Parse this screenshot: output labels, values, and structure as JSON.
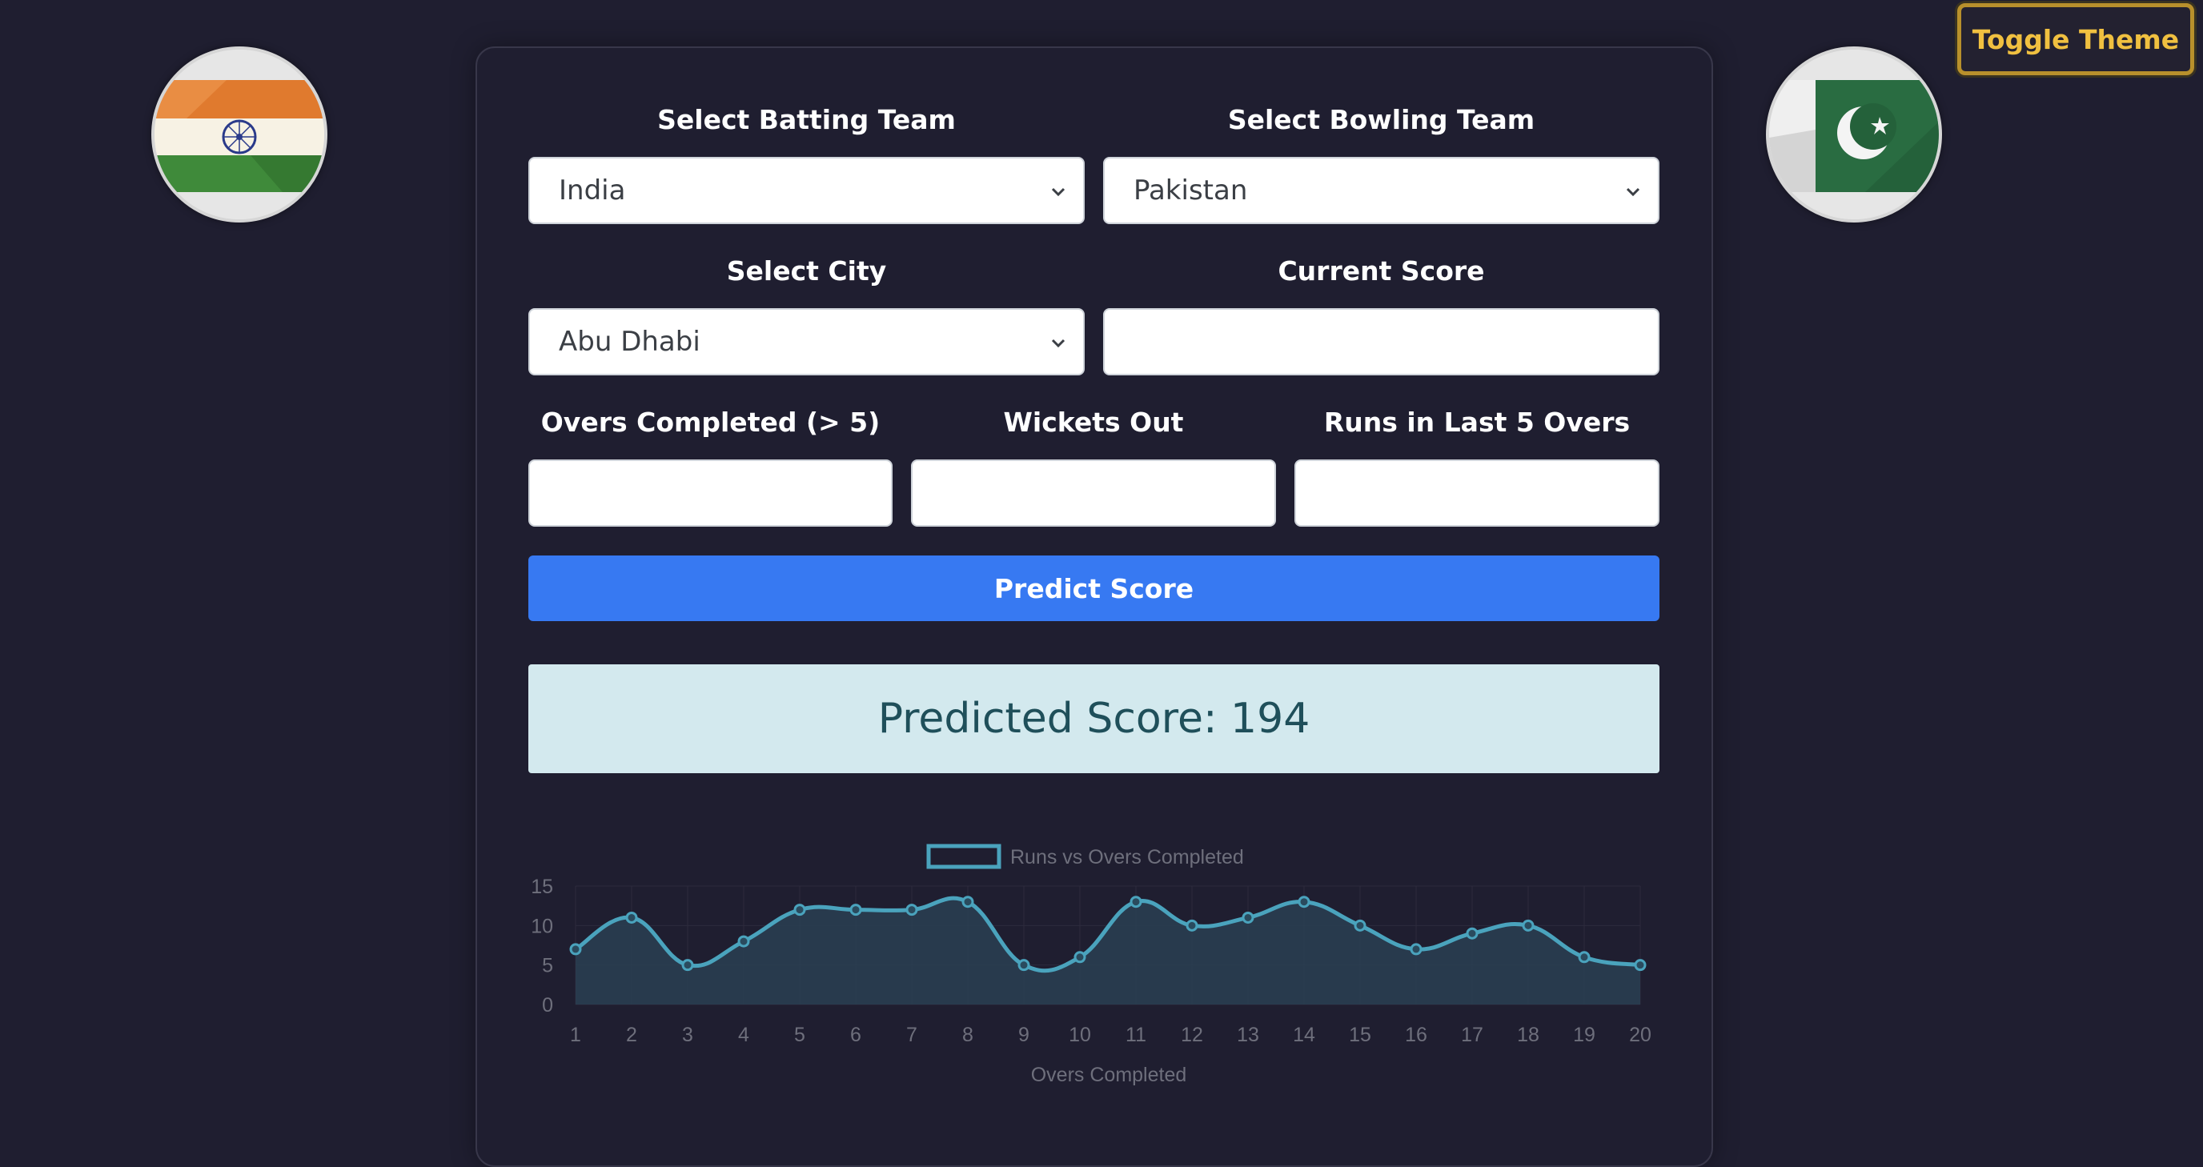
{
  "toolbar": {
    "toggle_theme_label": "Toggle Theme"
  },
  "flags": {
    "left": "India flag",
    "right": "Pakistan flag"
  },
  "form": {
    "batting_label": "Select Batting Team",
    "batting_value": "India",
    "bowling_label": "Select Bowling Team",
    "bowling_value": "Pakistan",
    "city_label": "Select City",
    "city_value": "Abu Dhabi",
    "score_label": "Current Score",
    "score_value": "",
    "overs_label": "Overs Completed (> 5)",
    "overs_value": "",
    "wickets_label": "Wickets Out",
    "wickets_value": "",
    "runs5_label": "Runs in Last 5 Overs",
    "runs5_value": "",
    "predict_label": "Predict Score"
  },
  "result": {
    "text": "Predicted Score: 194"
  },
  "colors": {
    "background": "#1f1e30",
    "primary_button": "#3779f2",
    "result_bg": "#d3e9ee",
    "result_text": "#1f4f5a",
    "line": "#4aa3bd",
    "toggle_text": "#f0c040",
    "toggle_border": "#b8902c"
  },
  "icons": {
    "select_arrow": "chevron-down-icon"
  },
  "chart_data": {
    "type": "line",
    "title": "",
    "legend": [
      "Runs vs Overs Completed"
    ],
    "legend_position": "top",
    "xlabel": "Overs Completed",
    "ylabel": "",
    "x": [
      1,
      2,
      3,
      4,
      5,
      6,
      7,
      8,
      9,
      10,
      11,
      12,
      13,
      14,
      15,
      16,
      17,
      18,
      19,
      20
    ],
    "series": [
      {
        "name": "Runs vs Overs Completed",
        "values": [
          7,
          11,
          5,
          8,
          12,
          12,
          12,
          13,
          5,
          6,
          13,
          10,
          11,
          13,
          10,
          7,
          9,
          10,
          6,
          5
        ]
      }
    ],
    "ylim": [
      0,
      15
    ],
    "yticks": [
      0,
      5,
      10,
      15
    ],
    "filled": true,
    "grid": true
  }
}
